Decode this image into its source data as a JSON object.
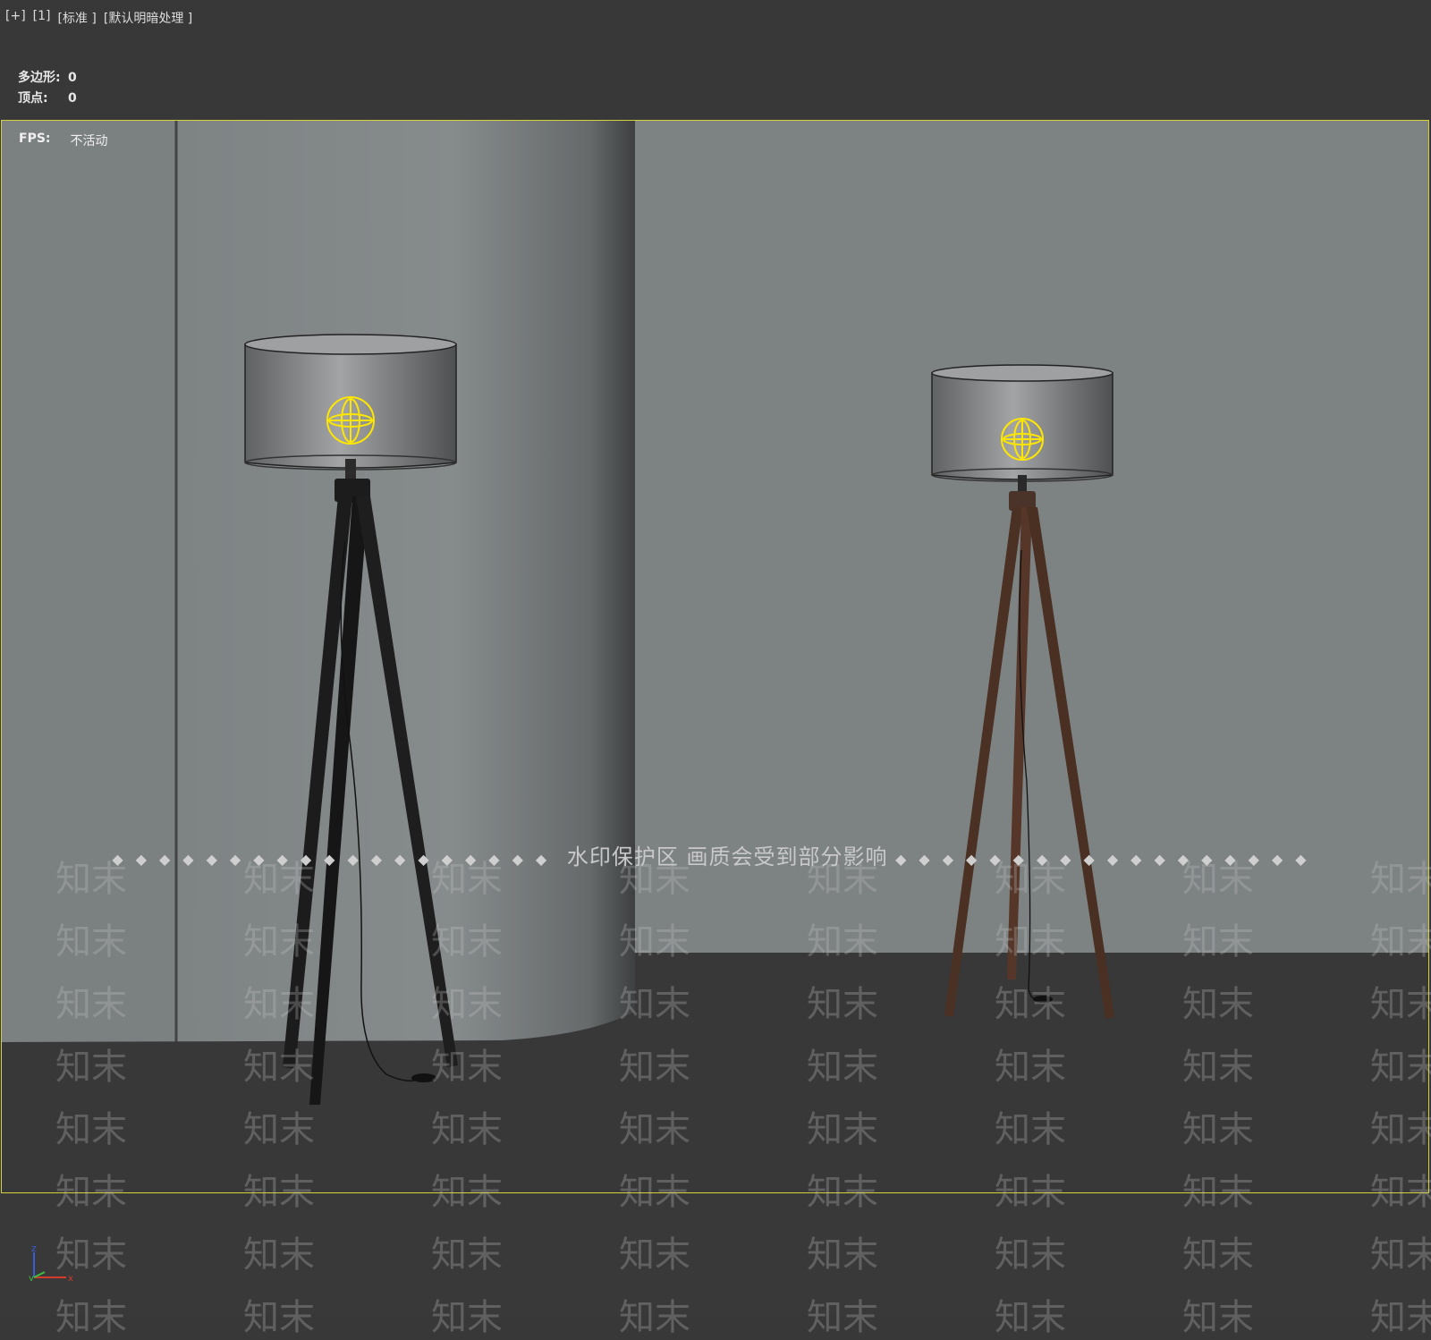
{
  "viewport_menu": {
    "plus": "[+]",
    "view": "[1]",
    "mode": "[标准 ]",
    "shading": "[默认明暗处理 ]"
  },
  "stats": {
    "polygons_label": "多边形:",
    "polygons_value": "0",
    "vertices_label": "顶点:",
    "vertices_value": "0"
  },
  "fps": {
    "label": "FPS:",
    "value": "不活动"
  },
  "watermark": {
    "banner": "水印保护区  画质会受到部分影响",
    "text": "知末"
  },
  "axis": {
    "z": "z",
    "y": "y",
    "x": "x"
  },
  "colors": {
    "viewport_border": "#d8d23a",
    "wall": "#7d8283",
    "floor": "#383838",
    "light_gizmo": "#ffe600"
  }
}
